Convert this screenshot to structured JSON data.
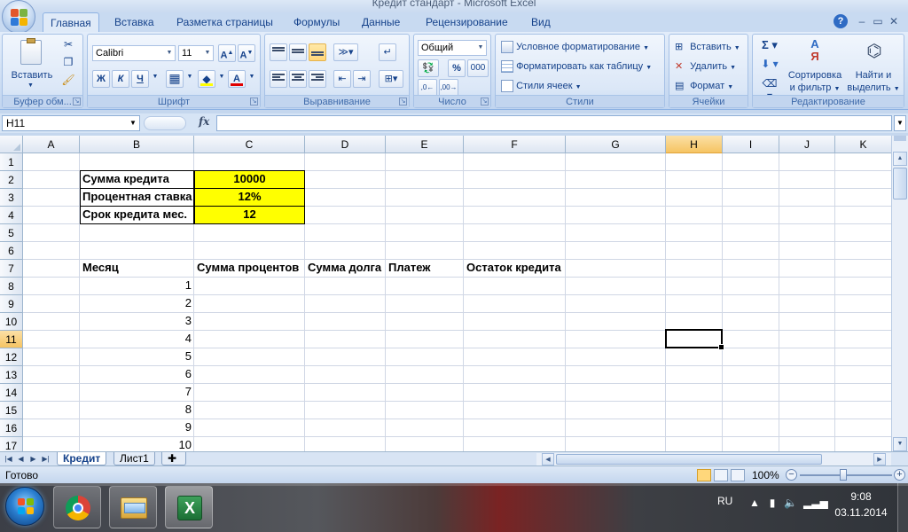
{
  "window": {
    "title": "Кредит стандарт - Microsoft Excel"
  },
  "ribbon_tabs": [
    "Главная",
    "Вставка",
    "Разметка страницы",
    "Формулы",
    "Данные",
    "Рецензирование",
    "Вид"
  ],
  "active_tab": "Главная",
  "ribbon": {
    "clipboard": {
      "label": "Буфер обм...",
      "paste": "Вставить"
    },
    "font": {
      "label": "Шрифт",
      "name": "Calibri",
      "size": "11",
      "bold": "Ж",
      "italic": "К",
      "underline": "Ч"
    },
    "alignment": {
      "label": "Выравнивание"
    },
    "number": {
      "label": "Число",
      "format": "Общий",
      "percent": "%",
      "thousands": "000"
    },
    "styles": {
      "label": "Стили",
      "conditional": "Условное форматирование",
      "as_table": "Форматировать как таблицу",
      "cell_styles": "Стили ячеек"
    },
    "cells": {
      "label": "Ячейки",
      "insert": "Вставить",
      "delete": "Удалить",
      "format": "Формат"
    },
    "editing": {
      "label": "Редактирование",
      "sort_line1": "Сортировка",
      "sort_line2": "и фильтр",
      "find_line1": "Найти и",
      "find_line2": "выделить"
    }
  },
  "formula_bar": {
    "name_box": "H11",
    "fx": "fx",
    "formula": ""
  },
  "columns": [
    "A",
    "B",
    "C",
    "D",
    "E",
    "F",
    "G",
    "H",
    "I",
    "J",
    "K"
  ],
  "selected_cell": {
    "ref": "H11",
    "column": "H",
    "row": 11
  },
  "rows": [
    "1",
    "2",
    "3",
    "4",
    "5",
    "6",
    "7",
    "8",
    "9",
    "10",
    "11",
    "12",
    "13",
    "14",
    "15",
    "16",
    "17"
  ],
  "cells": {
    "B2": "Сумма кредита",
    "C2": "10000",
    "B3": "Процентная ставка",
    "C3": "12%",
    "B4": "Срок кредита мес.",
    "C4": "12",
    "B7": "Месяц",
    "C7": "Сумма процентов",
    "D7": "Сумма долга",
    "E7": "Платеж",
    "F7": "Остаток кредита",
    "B8": "1",
    "B9": "2",
    "B10": "3",
    "B11": "4",
    "B12": "5",
    "B13": "6",
    "B14": "7",
    "B15": "8",
    "B16": "9",
    "B17": "10"
  },
  "input_fill_color": "#ffff00",
  "sheet_tabs": [
    "Кредит",
    "Лист1"
  ],
  "active_sheet": "Кредит",
  "status": {
    "text": "Готово",
    "zoom": "100%"
  },
  "taskbar": {
    "language": "RU",
    "time": "9:08",
    "date": "03.11.2014"
  }
}
